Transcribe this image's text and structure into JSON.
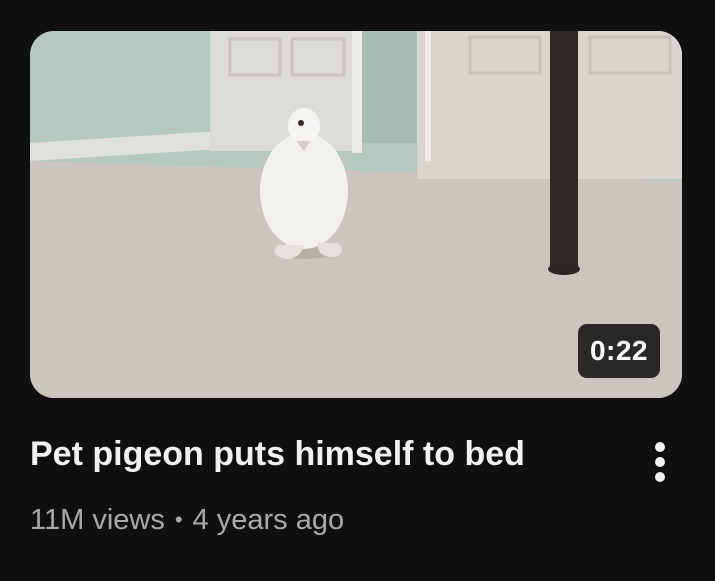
{
  "video": {
    "title": "Pet pigeon puts himself to bed",
    "duration": "0:22",
    "views": "11M views",
    "separator": "•",
    "age": "4 years ago"
  },
  "icons": {
    "menu": "more-vert-icon"
  },
  "colors": {
    "background": "#0f0f0f",
    "title": "#f1f1f1",
    "meta": "#aaaaaa",
    "duration_bg": "#000000"
  }
}
